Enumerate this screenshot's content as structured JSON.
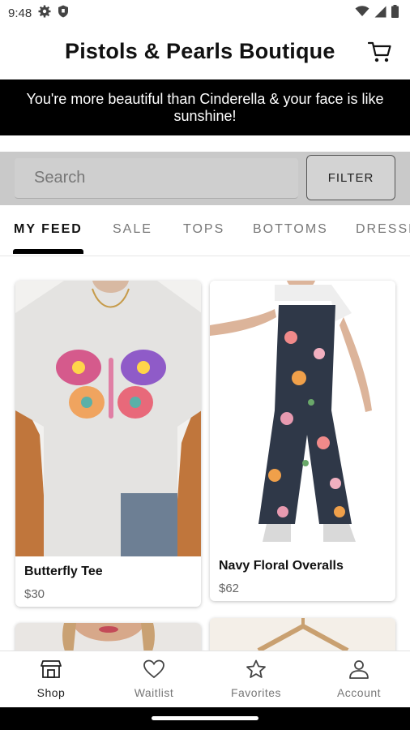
{
  "status_bar": {
    "time": "9:48"
  },
  "header": {
    "title": "Pistols & Pearls Boutique"
  },
  "banner": {
    "text": "You're more beautiful than Cinderella & your face is like sunshine!"
  },
  "search": {
    "placeholder": "Search",
    "filter_label": "FILTER"
  },
  "tabs": [
    {
      "label": "MY FEED"
    },
    {
      "label": "SALE"
    },
    {
      "label": "TOPS"
    },
    {
      "label": "BOTTOMS"
    },
    {
      "label": "DRESSES"
    }
  ],
  "products": [
    {
      "name": "Butterfly Tee",
      "price": "$30"
    },
    {
      "name": "Navy Floral Overalls",
      "price": "$62"
    }
  ],
  "bottom_nav": [
    {
      "label": "Shop",
      "icon": "shop-icon"
    },
    {
      "label": "Waitlist",
      "icon": "heart-icon"
    },
    {
      "label": "Favorites",
      "icon": "star-icon"
    },
    {
      "label": "Account",
      "icon": "account-icon"
    }
  ],
  "colors": {
    "banner_bg": "#000000",
    "search_band": "#c9c9c9",
    "accent": "#000000"
  }
}
